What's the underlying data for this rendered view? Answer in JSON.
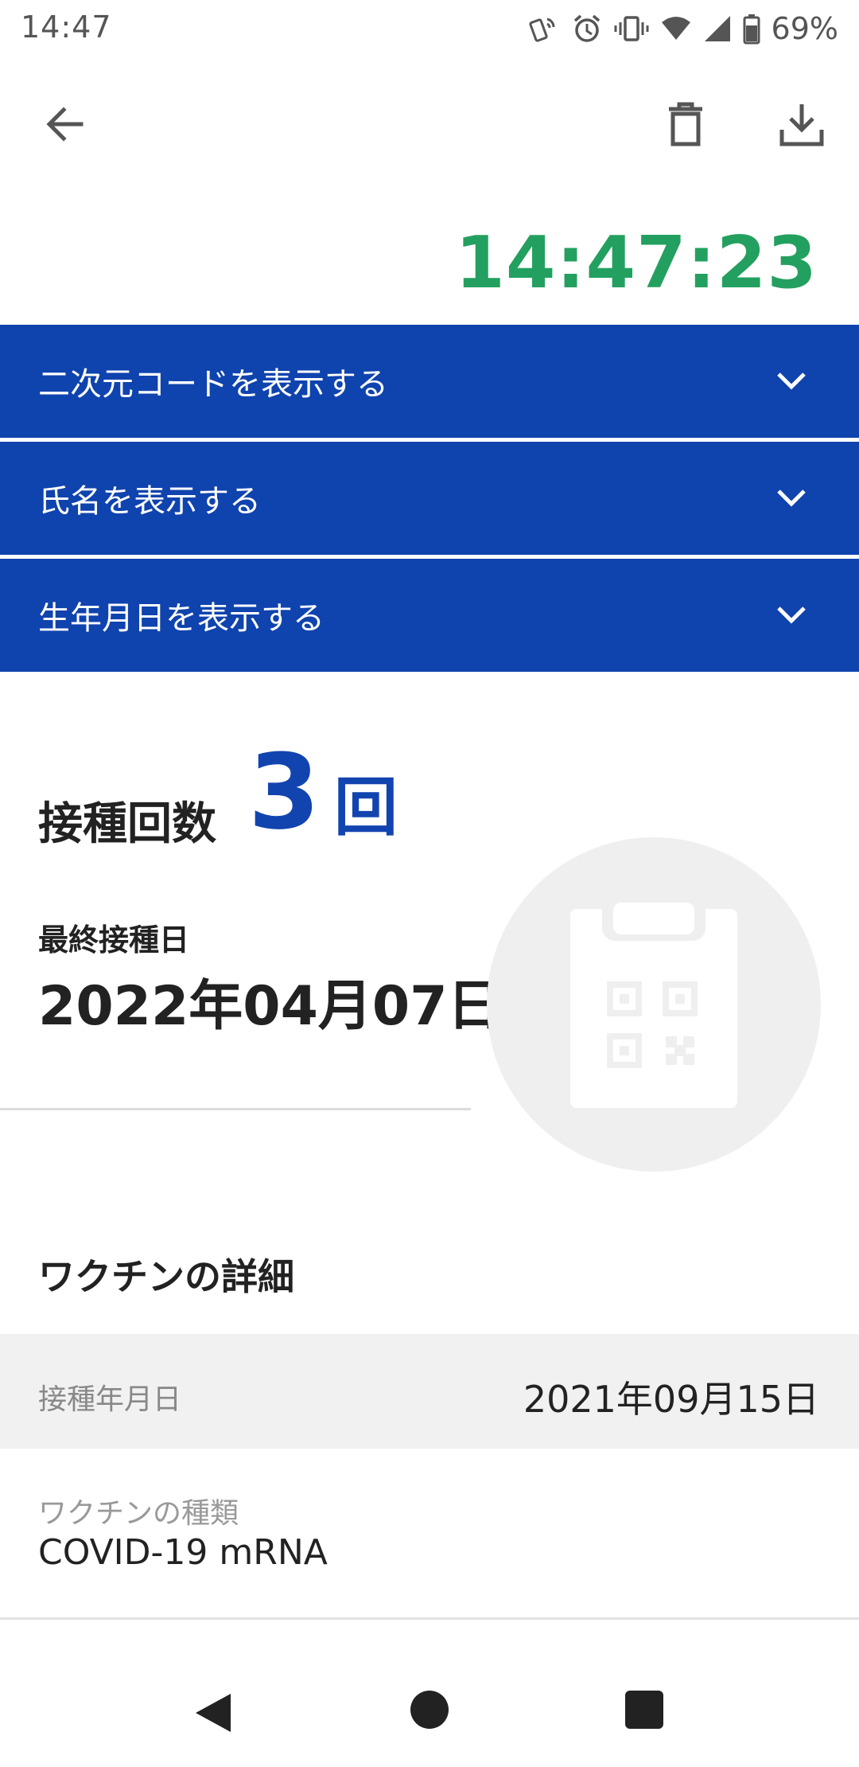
{
  "status_bar": {
    "time": "14:47",
    "battery": "69%",
    "icons": [
      "nfc-icon",
      "alarm-icon",
      "vibrate-icon",
      "wifi-icon",
      "signal-icon",
      "battery-icon"
    ]
  },
  "app_bar": {
    "back_icon": "arrow-left-icon",
    "delete_icon": "trash-icon",
    "download_icon": "download-icon"
  },
  "clock": "14:47:23",
  "accordion": [
    {
      "label": "二次元コードを表示する"
    },
    {
      "label": "氏名を表示する"
    },
    {
      "label": "生年月日を表示する"
    }
  ],
  "summary": {
    "dose_label": "接種回数",
    "dose_count": "3",
    "dose_unit": "回",
    "last_date_label": "最終接種日",
    "last_date_value": "2022年04月07日"
  },
  "details": {
    "heading": "ワクチンの詳細",
    "rows": [
      {
        "label": "接種年月日",
        "value": "2021年09月15日"
      },
      {
        "label": "ワクチンの種類",
        "value": "COVID-19 mRNA"
      }
    ]
  },
  "colors": {
    "accent_blue": "#0f43ae",
    "clock_green": "#23a05f"
  }
}
